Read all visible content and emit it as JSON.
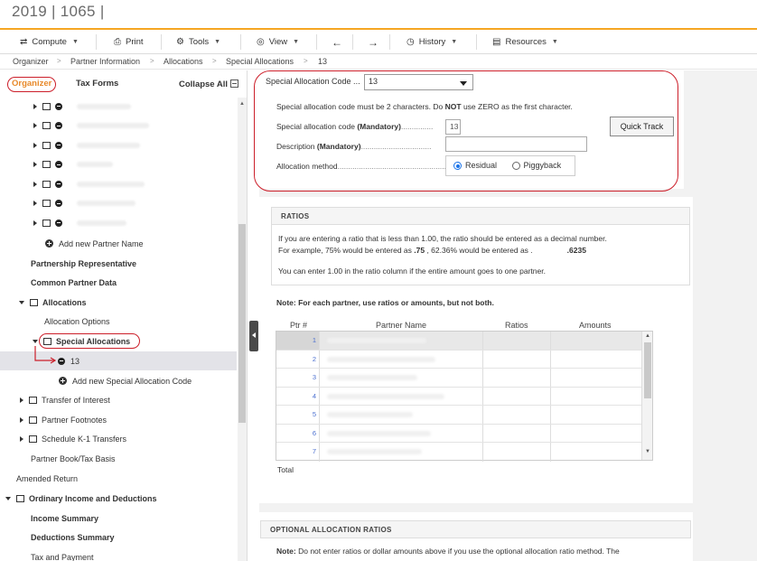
{
  "app": {
    "title": "2019 | 1065 |"
  },
  "toolbar": {
    "compute": "Compute",
    "print": "Print",
    "tools": "Tools",
    "view": "View",
    "history": "History",
    "resources": "Resources"
  },
  "breadcrumb": [
    "Organizer",
    "Partner Information",
    "Allocations",
    "Special Allocations",
    "13"
  ],
  "sidebar": {
    "tabs": {
      "organizer": "Organizer",
      "tax_forms": "Tax Forms",
      "collapse_all": "Collapse All"
    },
    "items": {
      "add_partner": "Add new Partner Name",
      "partnership_rep": "Partnership Representative",
      "common_partner": "Common Partner Data",
      "allocations": "Allocations",
      "allocation_options": "Allocation Options",
      "special_allocations": "Special Allocations",
      "code_13": "13",
      "add_special": "Add new Special Allocation Code",
      "transfer": "Transfer of Interest",
      "footnotes": "Partner Footnotes",
      "k1_transfers": "Schedule K-1 Transfers",
      "book_tax": "Partner Book/Tax Basis",
      "amended": "Amended Return",
      "ordinary": "Ordinary Income and Deductions",
      "income_summary": "Income Summary",
      "deductions_summary": "Deductions Summary",
      "tax_payment": "Tax and Payment"
    }
  },
  "form": {
    "code_select_label": "Special Allocation Code ...",
    "code_select_value": "13",
    "note": "Special allocation code must be 2 characters.   Do ",
    "note_bold": "NOT",
    "note_tail": " use ZERO as the first character.",
    "code_label": "Special allocation code ",
    "code_label_bold": "(Mandatory)",
    "code_label_dots": "...............",
    "code_value": "13",
    "desc_label": "Description ",
    "desc_label_bold": "(Mandatory)",
    "desc_label_dots": ".................................",
    "desc_value": "",
    "method_label": "Allocation method",
    "method_dots": ".......................................................",
    "residual": "Residual",
    "piggyback": "Piggyback",
    "quick_track": "Quick Track"
  },
  "ratios": {
    "header": "RATIOS",
    "line1": "If you are entering a ratio that is less than 1.00, the ratio should be entered as a decimal number.",
    "line2a": "For example, 75% would be entered as ",
    "line2b": ".75",
    "line2c": " , 62.36% would be entered as .",
    "line2d": ".6235",
    "line3": "You can enter 1.00 in the ratio column if the entire amount goes to one partner.",
    "note": "Note: For each partner, use ratios or amounts, but not both.",
    "col_ptr": "Ptr #",
    "col_name": "Partner Name",
    "col_ratios": "Ratios",
    "col_amounts": "Amounts",
    "rows": [
      "1",
      "2",
      "3",
      "4",
      "5",
      "6",
      "7"
    ],
    "total": "Total"
  },
  "optional": {
    "header": "OPTIONAL ALLOCATION RATIOS",
    "note_bold": "Note:",
    "note": " Do not enter ratios or dollar amounts above if you use the optional allocation ratio method. The"
  }
}
